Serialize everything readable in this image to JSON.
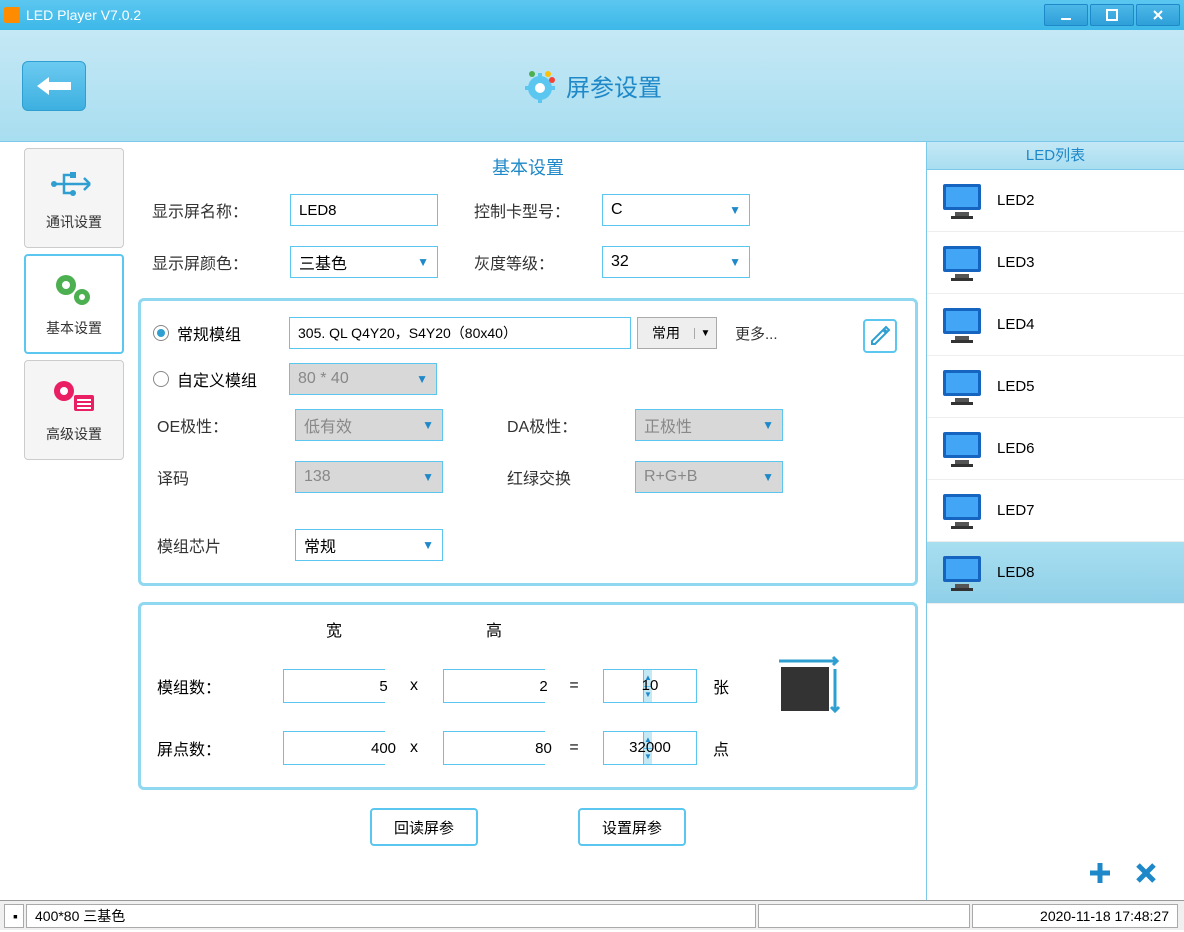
{
  "app": {
    "title": "LED Player V7.0.2"
  },
  "page": {
    "title": "屏参设置"
  },
  "tabs": {
    "comm": "通讯设置",
    "basic": "基本设置",
    "adv": "高级设置"
  },
  "section": {
    "basic": "基本设置"
  },
  "labels": {
    "screen_name": "显示屏名称：",
    "card_model": "控制卡型号：",
    "screen_color": "显示屏颜色：",
    "gray_level": "灰度等级：",
    "normal_module": "常规模组",
    "custom_module": "自定义模组",
    "oe_polarity": "OE极性：",
    "da_polarity": "DA极性：",
    "decode": "译码",
    "rg_swap": "红绿交换",
    "module_chip": "模组芯片",
    "common": "常用",
    "more": "更多...",
    "width": "宽",
    "height": "高",
    "module_count": "模组数：",
    "screen_dots": "屏点数：",
    "unit_sheets": "张",
    "unit_dots": "点"
  },
  "values": {
    "screen_name": "LED8",
    "card_model": "C",
    "screen_color": "三基色",
    "gray_level": "32",
    "module_desc": "305. QL Q4Y20，S4Y20（80x40）",
    "custom_size": "80 * 40",
    "oe": "低有效",
    "da": "正极性",
    "decode": "138",
    "rgb": "R+G+B",
    "chip": "常规",
    "mod_w": "5",
    "mod_h": "2",
    "mod_total": "10",
    "dot_w": "400",
    "dot_h": "80",
    "dot_total": "32000"
  },
  "buttons": {
    "read": "回读屏参",
    "set": "设置屏参"
  },
  "ledlist": {
    "title": "LED列表",
    "items": [
      "LED2",
      "LED3",
      "LED4",
      "LED5",
      "LED6",
      "LED7",
      "LED8"
    ],
    "selected": "LED8"
  },
  "status": {
    "info": "400*80 三基色",
    "datetime": "2020-11-18 17:48:27"
  }
}
